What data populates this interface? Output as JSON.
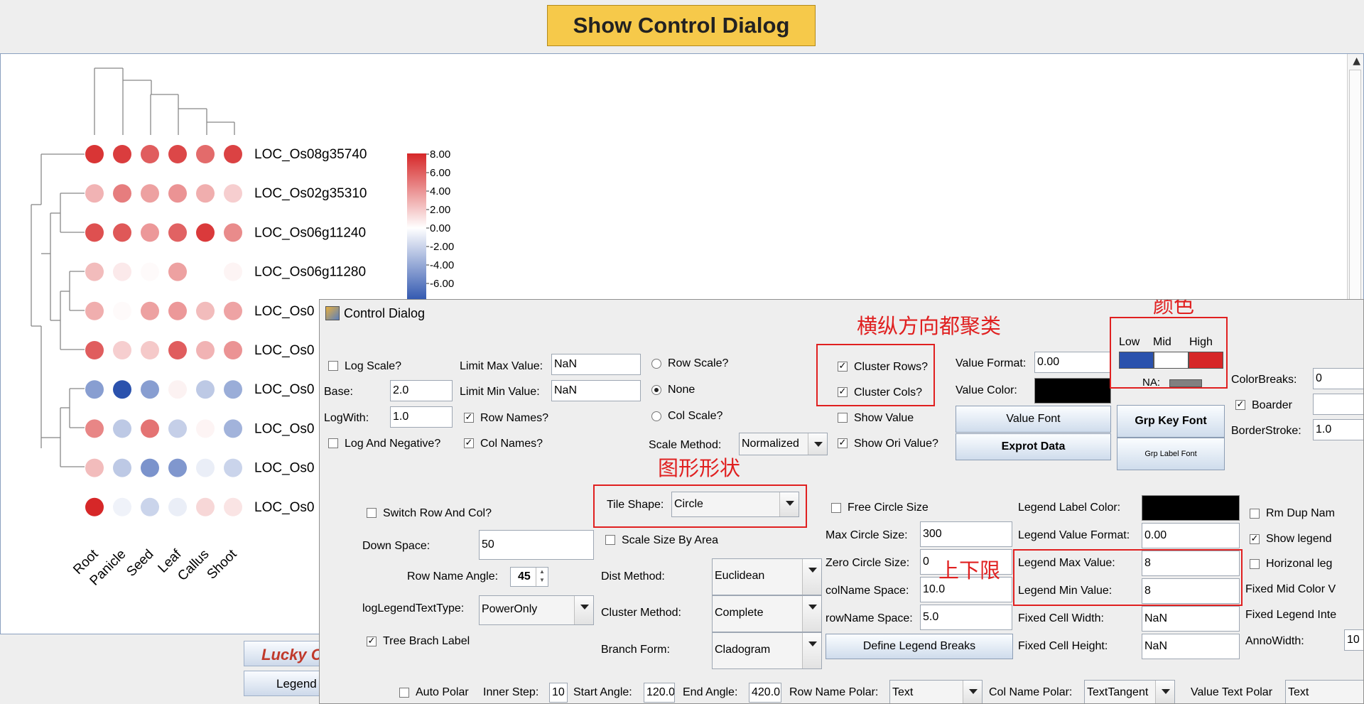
{
  "top_button": "Show Control Dialog",
  "heatmap": {
    "rows": [
      "LOC_Os08g35740",
      "LOC_Os02g35310",
      "LOC_Os06g11240",
      "LOC_Os06g11280",
      "LOC_Os0",
      "LOC_Os0",
      "LOC_Os0",
      "LOC_Os0",
      "LOC_Os0",
      "LOC_Os0"
    ],
    "cols": [
      "Root",
      "Panicle",
      "Seed",
      "Leaf",
      "Callus",
      "Shoot"
    ],
    "values": [
      [
        7.5,
        7.2,
        6.0,
        6.8,
        5.5,
        7.0
      ],
      [
        2.8,
        4.8,
        3.5,
        4.0,
        3.0,
        1.8
      ],
      [
        6.5,
        6.2,
        3.8,
        5.8,
        7.3,
        4.3
      ],
      [
        2.5,
        0.8,
        0.2,
        3.5,
        0.0,
        0.4
      ],
      [
        3.0,
        0.2,
        3.5,
        3.8,
        2.5,
        3.4
      ],
      [
        6.0,
        1.8,
        2.0,
        6.0,
        2.8,
        4.0
      ],
      [
        -4.5,
        -8.0,
        -4.5,
        0.5,
        -2.5,
        -3.8
      ],
      [
        4.5,
        -2.5,
        5.2,
        -2.2,
        0.4,
        -3.5
      ],
      [
        2.5,
        -2.5,
        -5.0,
        -4.8,
        -0.8,
        -2.0
      ],
      [
        8.0,
        -0.6,
        -2.0,
        -0.8,
        1.5,
        1.0
      ]
    ],
    "legend_ticks": [
      "8.00",
      "6.00",
      "4.00",
      "2.00",
      "0.00",
      "-2.00",
      "-4.00",
      "-6.00"
    ],
    "colors": {
      "low": "#2b52ad",
      "mid": "#ffffff",
      "high": "#d62728",
      "na": "#808080"
    }
  },
  "bottom_bar": {
    "lucky": "Lucky C",
    "legend": "Legend"
  },
  "dialog": {
    "title": "Control Dialog",
    "log_scale": "Log Scale?",
    "base_label": "Base:",
    "base_value": "2.0",
    "logwith_label": "LogWith:",
    "logwith_value": "1.0",
    "log_negative": "Log And Negative?",
    "limit_max_label": "Limit Max Value:",
    "limit_max_value": "NaN",
    "limit_min_label": "Limit Min Value:",
    "limit_min_value": "NaN",
    "row_names": "Row Names?",
    "col_names": "Col Names?",
    "row_scale": "Row Scale?",
    "none": "None",
    "col_scale": "Col Scale?",
    "scale_method_label": "Scale Method:",
    "scale_method_value": "Normalized",
    "cluster_rows": "Cluster Rows?",
    "cluster_cols": "Cluster Cols?",
    "show_value": "Show Value",
    "show_ori_value": "Show Ori Value?",
    "value_format_label": "Value Format:",
    "value_format_value": "0.00",
    "value_color_label": "Value Color:",
    "value_font": "Value Font",
    "export_data": "Exprot Data",
    "color_low": "Low",
    "color_mid": "Mid",
    "color_high": "High",
    "na": "NA:",
    "grp_key_font": "Grp Key Font",
    "grp_label_font": "Grp Label Font",
    "color_breaks_label": "ColorBreaks:",
    "color_breaks_value": "0",
    "boarder": "Boarder",
    "border_stroke_label": "BorderStroke:",
    "border_stroke_value": "1.0",
    "switch_row_col": "Switch Row And Col?",
    "down_space_label": "Down Space:",
    "down_space_value": "50",
    "row_name_angle_label": "Row Name Angle:",
    "row_name_angle_value": "45",
    "log_legend_label": "logLegendTextType:",
    "log_legend_value": "PowerOnly",
    "tree_branch_label": "Tree Brach Label",
    "tile_shape_label": "Tile Shape:",
    "tile_shape_value": "Circle",
    "scale_size_by_area": "Scale Size By Area",
    "dist_method_label": "Dist Method:",
    "dist_method_value": "Euclidean",
    "cluster_method_label": "Cluster Method:",
    "cluster_method_value": "Complete",
    "branch_form_label": "Branch Form:",
    "branch_form_value": "Cladogram",
    "free_circle_size": "Free Circle Size",
    "max_circle_label": "Max Circle Size:",
    "max_circle_value": "300",
    "zero_circle_label": "Zero Circle Size:",
    "zero_circle_value": "0",
    "colname_space_label": "colName Space:",
    "colname_space_value": "10.0",
    "rowname_space_label": "rowName Space:",
    "rowname_space_value": "5.0",
    "define_legend_breaks": "Define Legend Breaks",
    "legend_label_color_label": "Legend Label Color:",
    "legend_value_format_label": "Legend Value Format:",
    "legend_value_format_value": "0.00",
    "legend_max_label": "Legend Max Value:",
    "legend_max_value": "8",
    "legend_min_label": "Legend Min Value:",
    "legend_min_value": "8",
    "fixed_cell_width_label": "Fixed Cell Width:",
    "fixed_cell_width_value": "NaN",
    "fixed_cell_height_label": "Fixed Cell Height:",
    "fixed_cell_height_value": "NaN",
    "rm_dup_name": "Rm Dup Nam",
    "show_legend": "Show legend",
    "horizonal_legend": "Horizonal leg",
    "fixed_mid_color": "Fixed Mid Color V",
    "fixed_legend_interval": "Fixed Legend Inte",
    "anno_width_label": "AnnoWidth:",
    "anno_width_value": "10",
    "auto_polar": "Auto Polar",
    "inner_step_label": "Inner Step:",
    "inner_step_value": "10",
    "start_angle_label": "Start Angle:",
    "start_angle_value": "120.0",
    "end_angle_label": "End Angle:",
    "end_angle_value": "420.0",
    "row_name_polar_label": "Row Name Polar:",
    "row_name_polar_value": "Text",
    "col_name_polar_label": "Col Name Polar:",
    "col_name_polar_value": "TextTangent",
    "value_text_polar_label": "Value Text Polar",
    "value_text_polar_value": "Text"
  },
  "annotations": {
    "cluster": "横纵方向都聚类",
    "color": "颜色",
    "shape": "图形形状",
    "limits": "上下限"
  }
}
